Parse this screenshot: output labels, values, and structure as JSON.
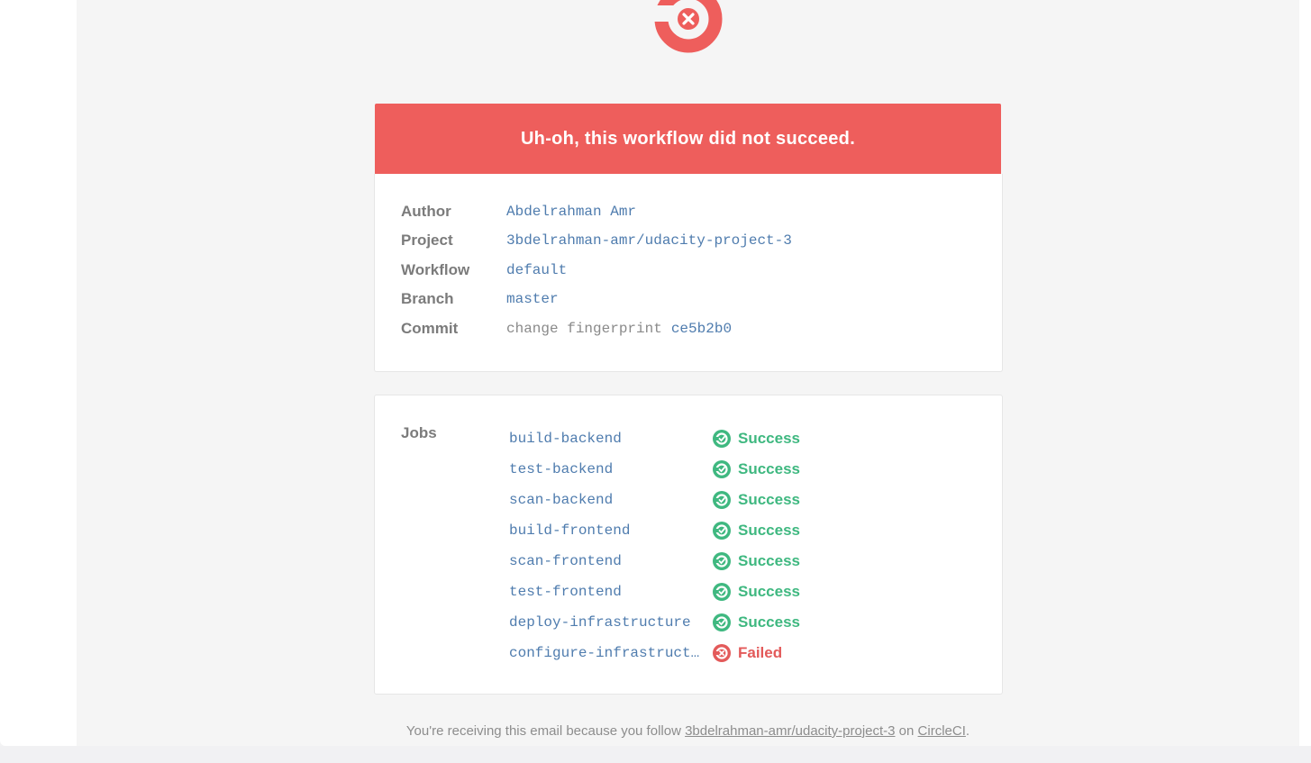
{
  "banner": {
    "title": "Uh-oh, this workflow did not succeed."
  },
  "details": [
    {
      "label": "Author",
      "value": "Abdelrahman Amr"
    },
    {
      "label": "Project",
      "value": "3bdelrahman-amr/udacity-project-3"
    },
    {
      "label": "Workflow",
      "value": "default"
    },
    {
      "label": "Branch",
      "value": "master"
    },
    {
      "label": "Commit",
      "message": "change fingerprint",
      "hash": "ce5b2b0"
    }
  ],
  "jobs": {
    "label": "Jobs",
    "items": [
      {
        "name": "build-backend",
        "status": "Success"
      },
      {
        "name": "test-backend",
        "status": "Success"
      },
      {
        "name": "scan-backend",
        "status": "Success"
      },
      {
        "name": "build-frontend",
        "status": "Success"
      },
      {
        "name": "scan-frontend",
        "status": "Success"
      },
      {
        "name": "test-frontend",
        "status": "Success"
      },
      {
        "name": "deploy-infrastructure",
        "status": "Success"
      },
      {
        "name": "configure-infrastructure",
        "status": "Failed"
      }
    ]
  },
  "footer": {
    "prefix": "You're receiving this email because you follow ",
    "project_link": "3bdelrahman-amr/udacity-project-3",
    "middle": " on ",
    "circleci_link": "CircleCI",
    "suffix": "."
  },
  "colors": {
    "banner": "#ee5e5c",
    "success": "#3fb880",
    "failed": "#e35a5a",
    "link_mono": "#4f7cae"
  },
  "icons": {
    "logo": "circleci-failed-logo-icon",
    "success": "success-status-icon",
    "failed": "failed-status-icon"
  }
}
